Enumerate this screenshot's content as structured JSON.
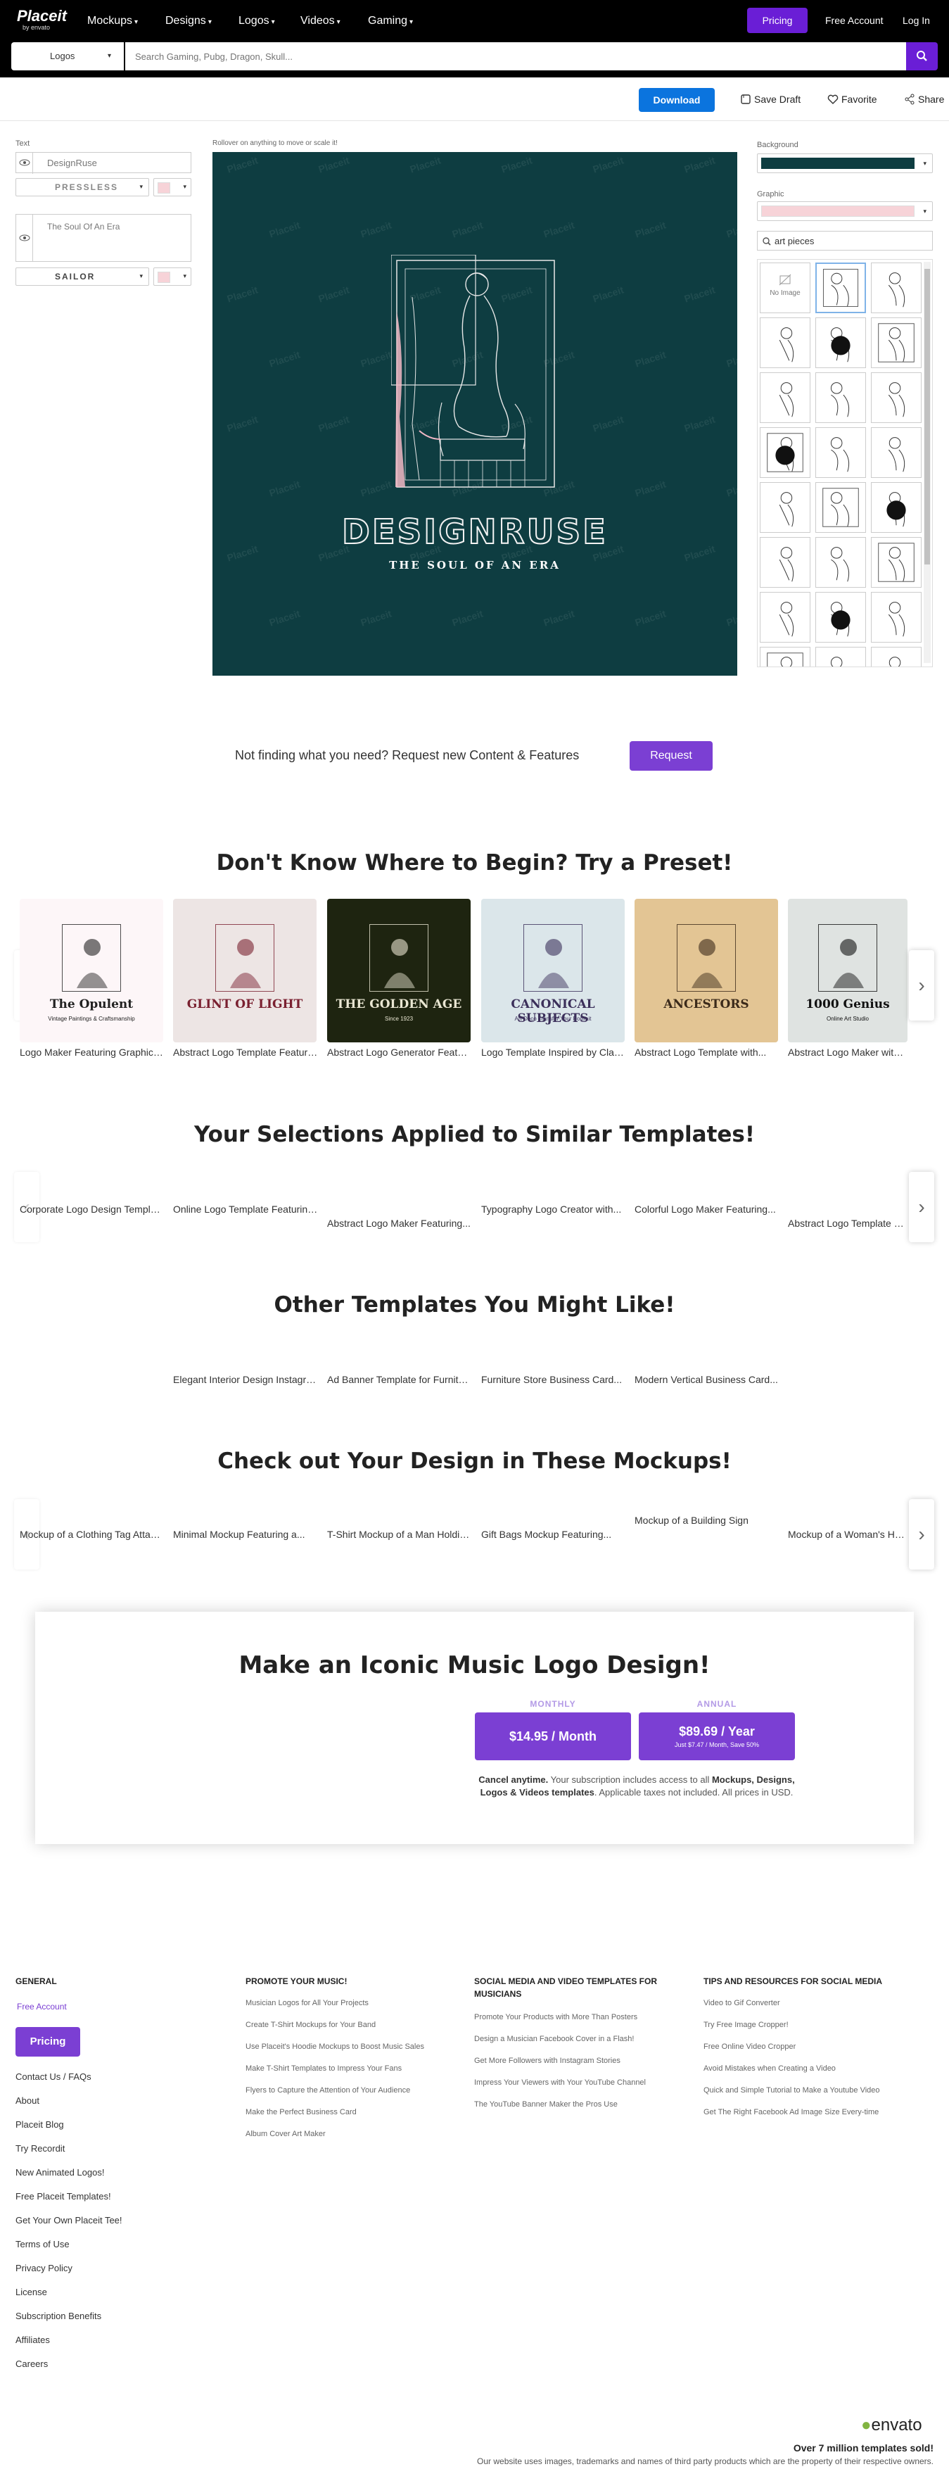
{
  "nav": {
    "logo_main": "Placeit",
    "logo_sub": "by envato",
    "items": [
      "Mockups",
      "Designs",
      "Logos",
      "Videos",
      "Gaming"
    ],
    "pricing": "Pricing",
    "free_account": "Free Account",
    "login": "Log In"
  },
  "search": {
    "category": "Logos",
    "placeholder": "Search Gaming, Pubg, Dragon, Skull..."
  },
  "toolbar": {
    "download": "Download",
    "save_draft": "Save Draft",
    "favorite": "Favorite",
    "share": "Share"
  },
  "editor": {
    "text_label": "Text",
    "text1": "DesignRuse",
    "font1": "PRESSLESS",
    "text2": "The Soul Of An Era",
    "font2": "SAILOR",
    "canvas_hint": "Rollover on anything to move or scale it!",
    "background_label": "Background",
    "background_color": "#0e3d41",
    "graphic_label": "Graphic",
    "graphic_color": "#f7d3d8",
    "graphic_search": "art pieces",
    "no_image": "No Image",
    "design_name": "DESIGNRUSE",
    "design_tagline": "THE SOUL OF AN ERA",
    "watermark": "Placeit"
  },
  "request": {
    "text": "Not finding what you need? Request new Content & Features",
    "button": "Request"
  },
  "presets": {
    "title": "Don't Know Where to Begin? Try a Preset!",
    "cards": [
      {
        "caption": "Logo Maker Featuring Graphics...",
        "art": "The Opulent",
        "art_sub": "Vintage Paintings & Craftsmanship",
        "bg": "#fdf6f8",
        "fg": "#222222"
      },
      {
        "caption": "Abstract Logo Template Featuring...",
        "art": "GLINT OF LIGHT",
        "art_sub": "",
        "bg": "#ede5e4",
        "fg": "#7a2030"
      },
      {
        "caption": "Abstract Logo Generator Featuring...",
        "art": "THE GOLDEN AGE",
        "art_sub": "Since 1923",
        "bg": "#1e2410",
        "fg": "#e9e6d2"
      },
      {
        "caption": "Logo Template Inspired by Classic...",
        "art": "CANONICAL SUBJECTS",
        "art_sub": "Art Deco Transfer Your Portrait",
        "bg": "#dbe6ea",
        "fg": "#3b2f5a"
      },
      {
        "caption": "Abstract Logo Template with...",
        "art": "ANCESTORS",
        "art_sub": "",
        "bg": "#e3c594",
        "fg": "#3b2a1a"
      },
      {
        "caption": "Abstract Logo Maker with a...",
        "art": "1000 Genius",
        "art_sub": "Online Art Studio",
        "bg": "#dfe3e1",
        "fg": "#111111"
      }
    ]
  },
  "similar": {
    "title": "Your Selections Applied to Similar Templates!",
    "captions": [
      "Corporate Logo Design Template...",
      "Online Logo Template Featuring...",
      "Abstract Logo Maker Featuring...",
      "Typography Logo Creator with...",
      "Colorful Logo Maker Featuring...",
      "Abstract Logo Template Featuring..."
    ]
  },
  "other": {
    "title": "Other Templates You Might Like!",
    "captions": [
      "Elegant Interior Design Instagram...",
      "Ad Banner Template for Furniture...",
      "Furniture Store Business Card...",
      "Modern Vertical Business Card..."
    ]
  },
  "mockups": {
    "title": "Check out Your Design in These Mockups!",
    "captions": [
      "Mockup of a Clothing Tag Attached...",
      "Minimal Mockup Featuring a...",
      "T-Shirt Mockup of a Man Holding...",
      "Gift Bags Mockup Featuring...",
      "Mockup of a Building Sign",
      "Mockup of a Woman's Hand..."
    ]
  },
  "promo": {
    "title": "Make an Iconic Music Logo Design!",
    "monthly_label": "MONTHLY",
    "monthly_price": "$14.95 / Month",
    "annual_label": "ANNUAL",
    "annual_price": "$89.69 / Year",
    "annual_sub": "Just $7.47 / Month, Save 50%",
    "note_bold": "Cancel anytime.",
    "note_mid": " Your subscription includes access to all ",
    "note_bold2": "Mockups, Designs, Logos & Videos templates",
    "note_end": ". Applicable taxes not included. All prices in USD."
  },
  "footer": {
    "general_head": "GENERAL",
    "free_account": "Free Account",
    "pricing": "Pricing",
    "general_links": [
      "Contact Us / FAQs",
      "About",
      "Placeit Blog",
      "Try Recordit",
      "New Animated Logos!",
      "Free Placeit Templates!",
      "Get Your Own Placeit Tee!",
      "Terms of Use",
      "Privacy Policy",
      "License",
      "Subscription Benefits",
      "Affiliates",
      "Careers"
    ],
    "col2_head": "PROMOTE YOUR MUSIC!",
    "col2": [
      "Musician Logos for All Your Projects",
      "Create T-Shirt Mockups for Your Band",
      "Use Placeit's Hoodie Mockups to Boost Music Sales",
      "Make T-Shirt Templates to Impress Your Fans",
      "Flyers to Capture the Attention of Your Audience",
      "Make the Perfect Business Card",
      "Album Cover Art Maker"
    ],
    "col3_head": "SOCIAL MEDIA AND VIDEO TEMPLATES FOR MUSICIANS",
    "col3": [
      "Promote Your Products with More Than Posters",
      "Design a Musician Facebook Cover in a Flash!",
      "Get More Followers with Instagram Stories",
      "Impress Your Viewers with Your YouTube Channel",
      "The YouTube Banner Maker the Pros Use"
    ],
    "col4_head": "TIPS AND RESOURCES FOR SOCIAL MEDIA",
    "col4": [
      "Video to Gif Converter",
      "Try Free Image Cropper!",
      "Free Online Video Cropper",
      "Avoid Mistakes when Creating a Video",
      "Quick and Simple Tutorial to Make a Youtube Video",
      "Get The Right Facebook Ad Image Size Every-time"
    ],
    "envato": "envato",
    "sold": "Over 7 million templates sold!",
    "disclaimer": "Our website uses images, trademarks and names of third party products which are the property of their respective owners."
  }
}
